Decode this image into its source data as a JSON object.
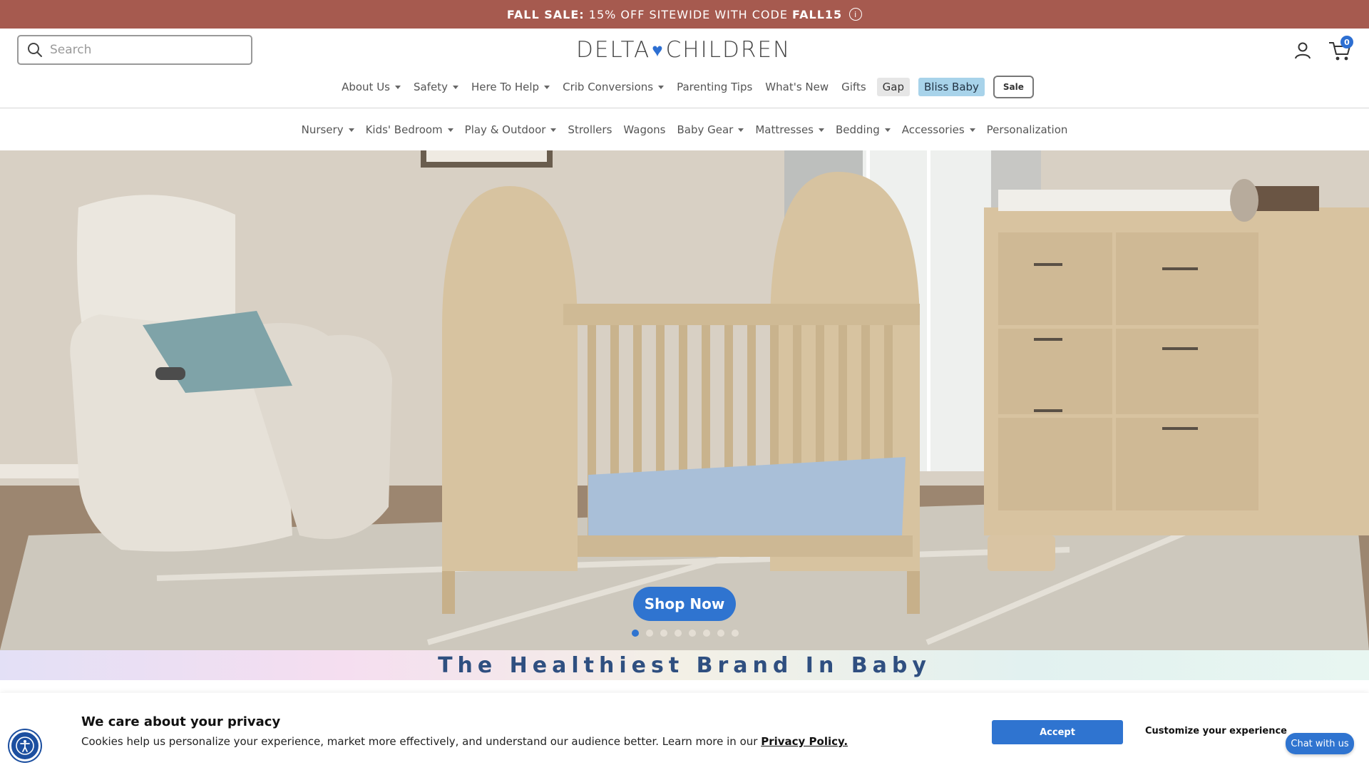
{
  "promo": {
    "lead": "FALL SALE:",
    "text": "15% OFF SITEWIDE WITH CODE",
    "code": "FALL15",
    "info_icon": "info-icon"
  },
  "header": {
    "search_placeholder": "Search",
    "logo_left": "DELTA",
    "logo_right": "CHILDREN",
    "cart_count": "0"
  },
  "nav_top": [
    {
      "label": "About Us",
      "dropdown": true
    },
    {
      "label": "Safety",
      "dropdown": true
    },
    {
      "label": "Here To Help",
      "dropdown": true
    },
    {
      "label": "Crib Conversions",
      "dropdown": true
    },
    {
      "label": "Parenting Tips",
      "dropdown": false
    },
    {
      "label": "What's New",
      "dropdown": false
    },
    {
      "label": "Gifts",
      "dropdown": false
    },
    {
      "label": "Gap",
      "dropdown": false
    },
    {
      "label": "Bliss Baby",
      "dropdown": false
    },
    {
      "label": "Sale",
      "dropdown": false
    }
  ],
  "nav_categories": [
    {
      "label": "Nursery",
      "dropdown": true
    },
    {
      "label": "Kids' Bedroom",
      "dropdown": true
    },
    {
      "label": "Play & Outdoor",
      "dropdown": true
    },
    {
      "label": "Strollers",
      "dropdown": false
    },
    {
      "label": "Wagons",
      "dropdown": false
    },
    {
      "label": "Baby Gear",
      "dropdown": true
    },
    {
      "label": "Mattresses",
      "dropdown": true
    },
    {
      "label": "Bedding",
      "dropdown": true
    },
    {
      "label": "Accessories",
      "dropdown": true
    },
    {
      "label": "Personalization",
      "dropdown": false
    }
  ],
  "hero": {
    "cta": "Shop Now",
    "slide_count": 8,
    "active_slide": 1
  },
  "tagline": "The Healthiest Brand In Baby",
  "cookie": {
    "title": "We care about your privacy",
    "body": "Cookies help us personalize your experience, market more effectively, and understand our audience better. Learn more in our",
    "link": "Privacy Policy.",
    "accept": "Accept",
    "customize": "Customize your experience"
  },
  "chat": "Chat with us",
  "colors": {
    "promo": "#a65a4f",
    "brand_blue": "#2f74d0",
    "bliss_pill": "#a8d3ea"
  }
}
